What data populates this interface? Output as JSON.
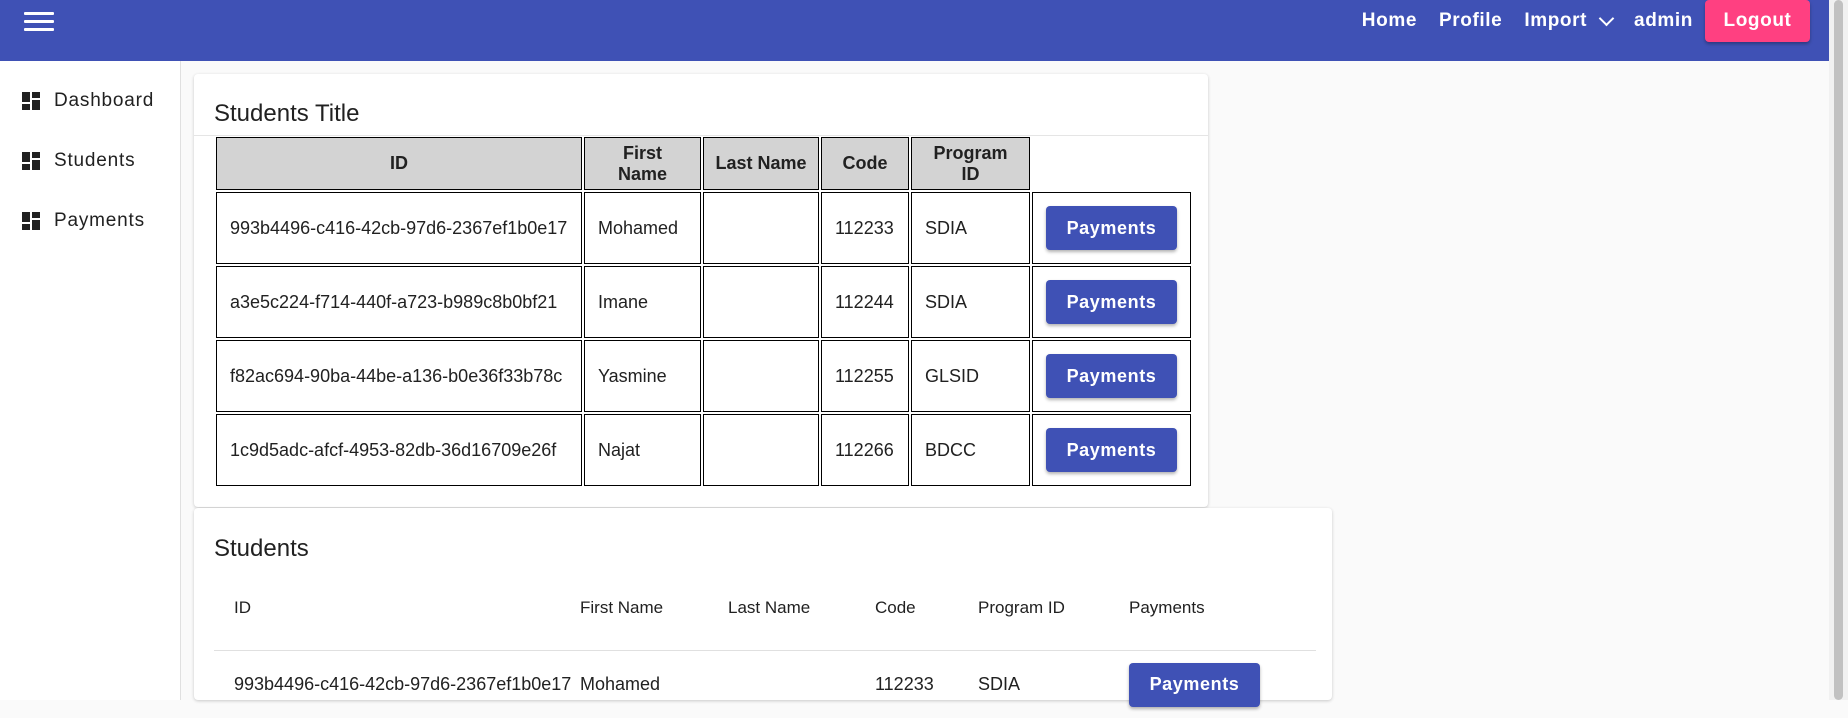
{
  "header": {
    "nav": {
      "home": "Home",
      "profile": "Profile",
      "import": "Import"
    },
    "user": "admin",
    "logout": "Logout",
    "color": "#3f51b5",
    "logout_color": "#ff4081"
  },
  "sidebar": {
    "items": [
      {
        "label": "Dashboard",
        "icon": "dashboard-icon"
      },
      {
        "label": "Students",
        "icon": "dashboard-icon"
      },
      {
        "label": "Payments",
        "icon": "dashboard-icon"
      }
    ]
  },
  "students_table": {
    "title": "Students Title",
    "headers": [
      "ID",
      "First Name",
      "Last Name",
      "Code",
      "Program ID"
    ],
    "payments_label": "Payments",
    "rows": [
      {
        "id": "993b4496-c416-42cb-97d6-2367ef1b0e17",
        "first_name": "Mohamed",
        "last_name": "",
        "code": "112233",
        "program_id": "SDIA"
      },
      {
        "id": "a3e5c224-f714-440f-a723-b989c8b0bf21",
        "first_name": "Imane",
        "last_name": "",
        "code": "112244",
        "program_id": "SDIA"
      },
      {
        "id": "f82ac694-90ba-44be-a136-b0e36f33b78c",
        "first_name": "Yasmine",
        "last_name": "",
        "code": "112255",
        "program_id": "GLSID"
      },
      {
        "id": "1c9d5adc-afcf-4953-82db-36d16709e26f",
        "first_name": "Najat",
        "last_name": "",
        "code": "112266",
        "program_id": "BDCC"
      }
    ]
  },
  "students_mat_table": {
    "title": "Students",
    "headers": [
      "ID",
      "First Name",
      "Last Name",
      "Code",
      "Program ID",
      "Payments"
    ],
    "payments_label": "Payments",
    "rows": [
      {
        "id": "993b4496-c416-42cb-97d6-2367ef1b0e17",
        "first_name": "Mohamed",
        "last_name": "",
        "code": "112233",
        "program_id": "SDIA"
      }
    ]
  }
}
